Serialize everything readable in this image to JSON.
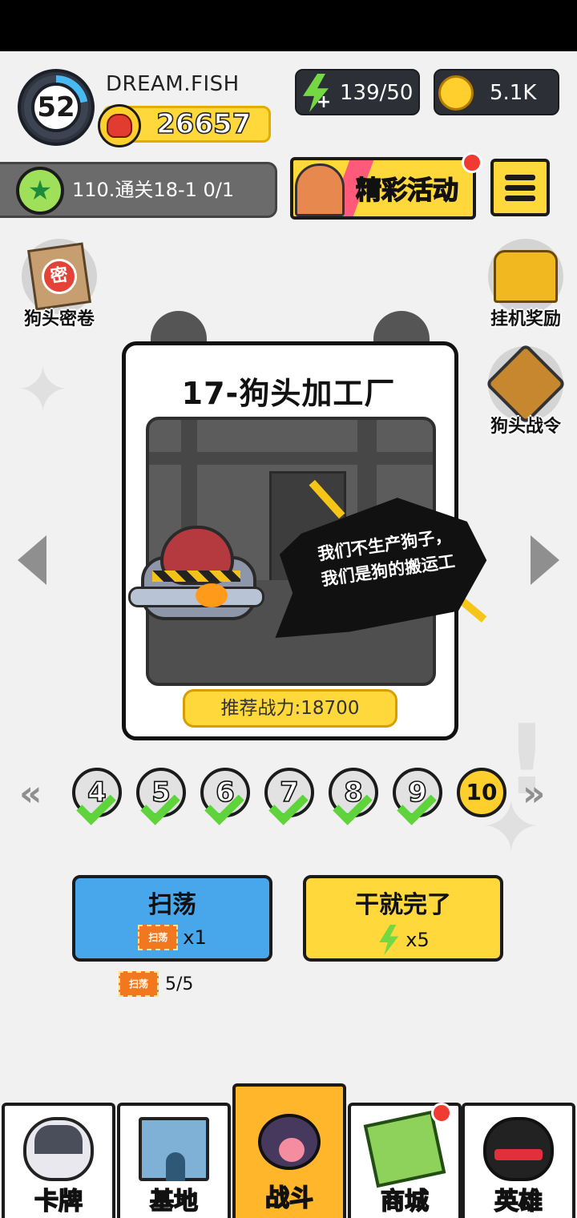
{
  "player": {
    "level": "52",
    "name": "DREAM.FISH",
    "power": "26657"
  },
  "resources": {
    "energy": "139/50",
    "coins": "5.1K"
  },
  "mission": {
    "text": "110.通关18-1  0/1"
  },
  "event_banner": {
    "label": "精彩活动"
  },
  "shortcuts": {
    "secret_scroll": "狗头密卷",
    "idle_reward": "挂机奖励",
    "battle_pass": "狗头战令"
  },
  "stage": {
    "title": "17-狗头加工厂",
    "dialogue_line1": "我们不生产狗子，",
    "dialogue_line2": "我们是狗的搬运工",
    "recommended_power": "推荐战力:18700"
  },
  "stage_selector": {
    "prev": "«",
    "next": "»",
    "nodes": [
      "4",
      "5",
      "6",
      "7",
      "8",
      "9",
      "10"
    ],
    "current": "10"
  },
  "actions": {
    "sweep_label": "扫荡",
    "sweep_cost": "x1",
    "go_label": "干就完了",
    "go_cost": "x5",
    "ticket_text": "扫荡",
    "ticket_count": "5/5"
  },
  "nav": {
    "tabs": [
      "卡牌",
      "基地",
      "战斗",
      "商城",
      "英雄"
    ],
    "active": "战斗"
  },
  "colors": {
    "accent_yellow": "#ffd93b",
    "sweep_blue": "#48a6ea",
    "active_tab": "#ffb62b",
    "energy_green": "#74d843",
    "check_green": "#5fd33a",
    "notify_red": "#f03b32"
  },
  "icons": {
    "energy": "lightning-bolt-icon",
    "coin": "coin-icon",
    "power": "boxing-glove-icon",
    "mission": "star-icon",
    "menu": "hamburger-icon"
  }
}
